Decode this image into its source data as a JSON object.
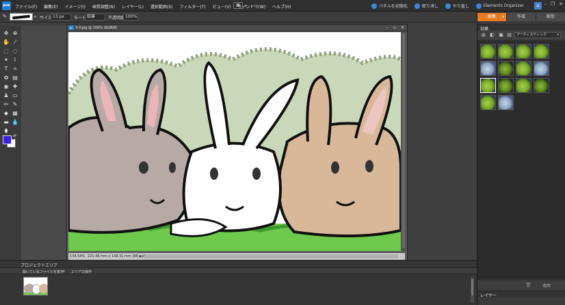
{
  "app": {
    "logo": "pse"
  },
  "menu": [
    "ファイル(F)",
    "編集(E)",
    "イメージ(I)",
    "画質調整(N)",
    "レイヤー(L)",
    "選択範囲(S)",
    "フィルター(T)",
    "ビュー(V)",
    "ウィンドウ(W)",
    "ヘルプ(H)"
  ],
  "topright": {
    "share": "パネルを初期化",
    "undo": "取り消し",
    "redo": "やり直し",
    "organizer": "Elements Organizer"
  },
  "options": {
    "size_label": "サイズ:",
    "size_value": "13 px",
    "mode_label": "モード:",
    "mode_value": "鉛筆",
    "opacity_label": "不透明度:",
    "opacity_value": "100%"
  },
  "document": {
    "title": "3-3.jpg @ 100% (RGB/8)",
    "zoom": "134.54%",
    "info": "221.46 mm x 149.31 mm (88 ppi)"
  },
  "project_bin": {
    "title": "プロジェクトエリア",
    "show_label": "開いているファイルを表示",
    "action_label": "エリアの操作"
  },
  "right_panel": {
    "tabs": [
      "編集",
      "作成",
      "配信"
    ],
    "effects_title": "効果",
    "category": "アーティスティック",
    "apply": "適用",
    "layers_title": "レイヤー"
  },
  "colors": {
    "foreground": "#3a1fe8",
    "background": "#ffffff",
    "active_tab": "#e87b1e"
  }
}
